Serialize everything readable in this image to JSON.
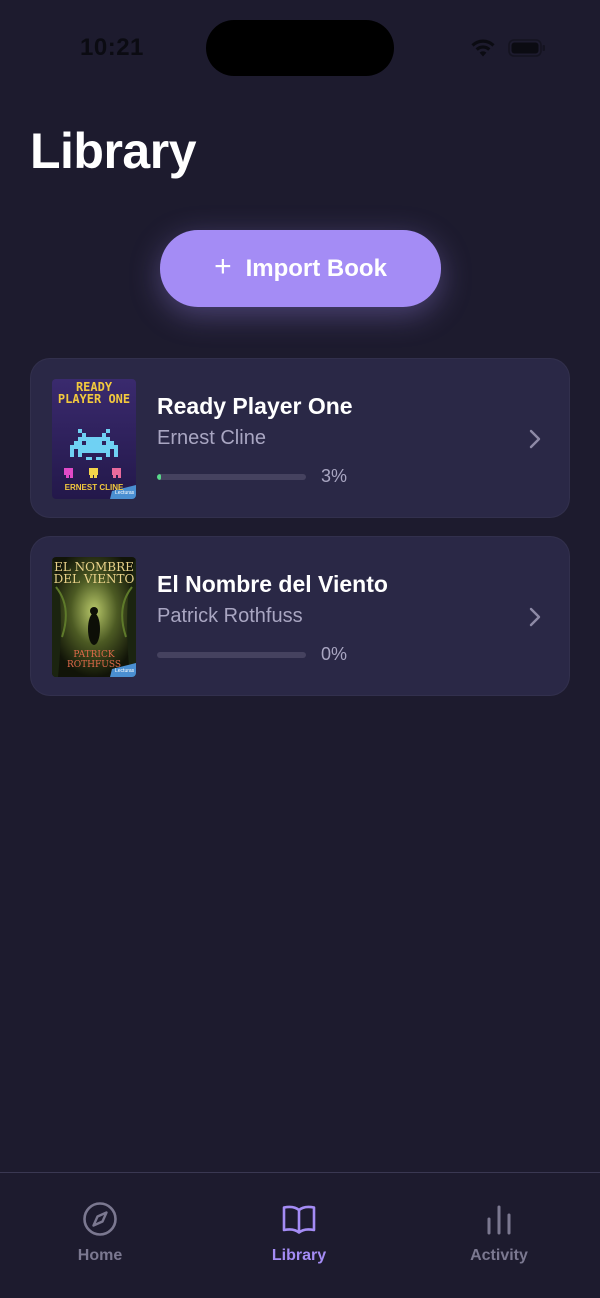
{
  "status_bar": {
    "time": "10:21"
  },
  "screen_title": "Library",
  "import_button": {
    "icon": "plus-icon",
    "label": "Import Book"
  },
  "books": [
    {
      "title": "Ready Player One",
      "author": "Ernest Cline",
      "progress_percent": 3,
      "progress_label": "3%",
      "cover": {
        "title_text": "READY PLAYER ONE",
        "author_text": "ERNEST CLINE",
        "badge": "Lecturas"
      }
    },
    {
      "title": "El Nombre del Viento",
      "author": "Patrick Rothfuss",
      "progress_percent": 0,
      "progress_label": "0%",
      "cover": {
        "title_text": "EL NOMBRE DEL VIENTO",
        "author_text": "PATRICK ROTHFUSS",
        "badge": "Lecturas"
      }
    }
  ],
  "tab_bar": {
    "active": "library",
    "tabs": [
      {
        "id": "home",
        "label": "Home",
        "icon": "compass-icon"
      },
      {
        "id": "library",
        "label": "Library",
        "icon": "book-open-icon"
      },
      {
        "id": "activity",
        "label": "Activity",
        "icon": "bar-chart-icon"
      }
    ]
  },
  "colors": {
    "background": "#1d1b2e",
    "card": "#2a2846",
    "accent": "#a48cf5",
    "progress": "#58d98a",
    "inactive": "#7b7890"
  }
}
